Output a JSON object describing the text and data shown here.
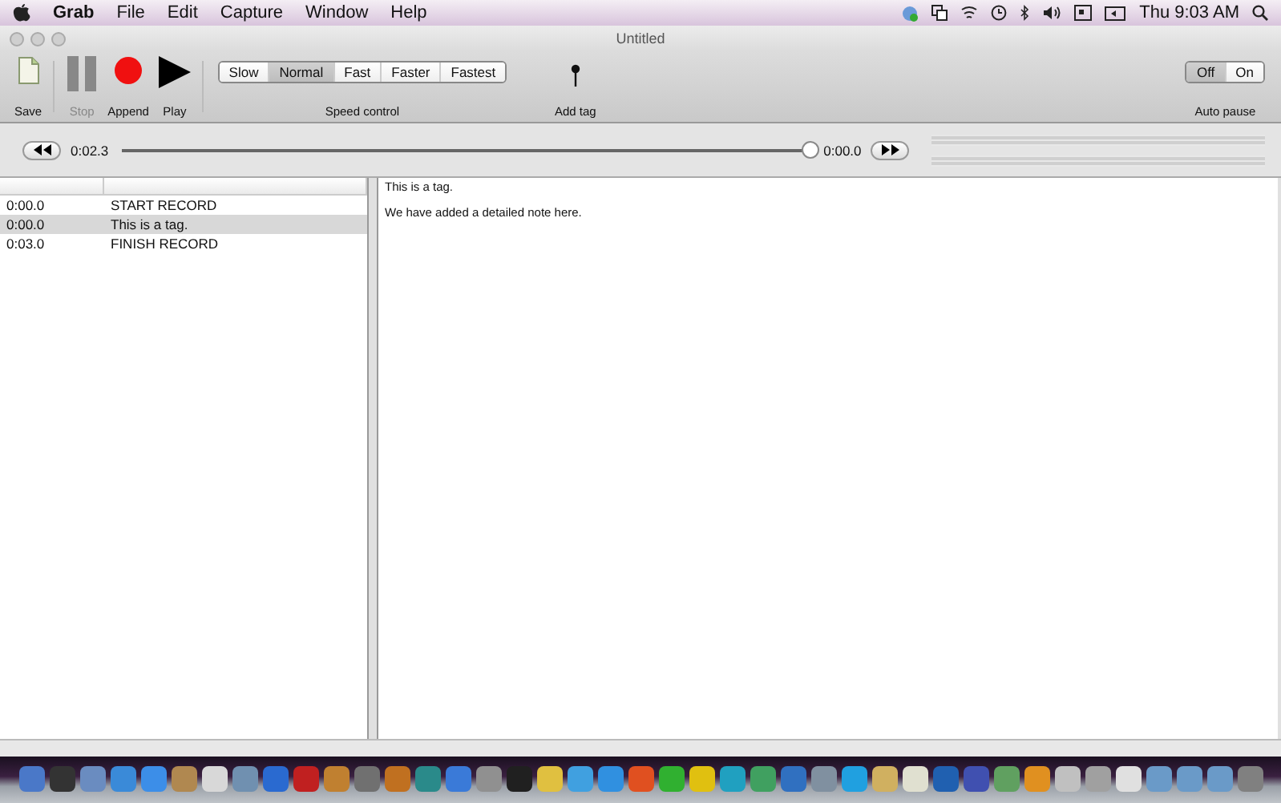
{
  "menu_bar": {
    "app": "Grab",
    "items": [
      "File",
      "Edit",
      "Capture",
      "Window",
      "Help"
    ],
    "clock": "Thu 9:03 AM"
  },
  "window": {
    "title": "Untitled"
  },
  "toolbar": {
    "buttons": [
      {
        "kind": "save",
        "label": "Save",
        "disabled": false
      },
      {
        "kind": "stop",
        "label": "Stop",
        "disabled": true
      },
      {
        "kind": "record",
        "label": "Append",
        "disabled": false
      },
      {
        "kind": "play",
        "label": "Play",
        "disabled": false
      }
    ],
    "speed_control": {
      "label": "Speed control",
      "options": [
        {
          "label": "Slow",
          "selected": false
        },
        {
          "label": "Normal",
          "selected": true
        },
        {
          "label": "Fast",
          "selected": false
        },
        {
          "label": "Faster",
          "selected": false
        },
        {
          "label": "Fastest",
          "selected": false
        }
      ]
    },
    "add_tag": {
      "label": "Add tag"
    },
    "auto_pause": {
      "label": "Auto pause",
      "options": [
        {
          "label": "Off",
          "selected": true
        },
        {
          "label": "On",
          "selected": false
        }
      ]
    }
  },
  "transport": {
    "elapsed": "0:02.3",
    "remaining": "0:00.0",
    "level": 1
  },
  "tags": [
    {
      "time": "0:00.0",
      "label": "START RECORD",
      "selected": false
    },
    {
      "time": "0:00.0",
      "label": "This is a tag.",
      "selected": true
    },
    {
      "time": "0:03.0",
      "label": "FINISH RECORD",
      "selected": false
    }
  ],
  "detail": {
    "title": "This is a tag.",
    "note": "We have added a detailed note here."
  },
  "dock": {
    "apps": [
      {
        "color": "#4a78c8"
      },
      {
        "color": "#333333"
      },
      {
        "color": "#6a8cc0"
      },
      {
        "color": "#3a8ad8"
      },
      {
        "color": "#3c8ee8"
      },
      {
        "color": "#b08850"
      },
      {
        "color": "#d8d8d8"
      },
      {
        "color": "#7090b0"
      },
      {
        "color": "#2a6ad0"
      },
      {
        "color": "#c02020"
      },
      {
        "color": "#c08030"
      },
      {
        "color": "#707070"
      },
      {
        "color": "#c07020"
      },
      {
        "color": "#2a8a8a"
      },
      {
        "color": "#3a7ad8"
      },
      {
        "color": "#909090"
      },
      {
        "color": "#202020"
      },
      {
        "color": "#e0c040"
      },
      {
        "color": "#40a0e0"
      },
      {
        "color": "#3090e0"
      },
      {
        "color": "#e05020"
      },
      {
        "color": "#30b030"
      },
      {
        "color": "#e0c010"
      },
      {
        "color": "#20a0c0"
      },
      {
        "color": "#40a060"
      },
      {
        "color": "#3070c0"
      },
      {
        "color": "#8090a0"
      },
      {
        "color": "#20a0e0"
      },
      {
        "color": "#d0b060"
      },
      {
        "color": "#e0e0d0"
      },
      {
        "color": "#2060b0"
      },
      {
        "color": "#4050b0"
      },
      {
        "color": "#60a060"
      },
      {
        "color": "#e09020"
      },
      {
        "color": "#c0c0c0"
      },
      {
        "color": "#a0a0a0"
      },
      {
        "color": "#e0e0e0"
      },
      {
        "color": "#6a9ac8"
      },
      {
        "color": "#6a9ac8"
      },
      {
        "color": "#6a9ac8"
      },
      {
        "color": "#808080"
      }
    ]
  }
}
